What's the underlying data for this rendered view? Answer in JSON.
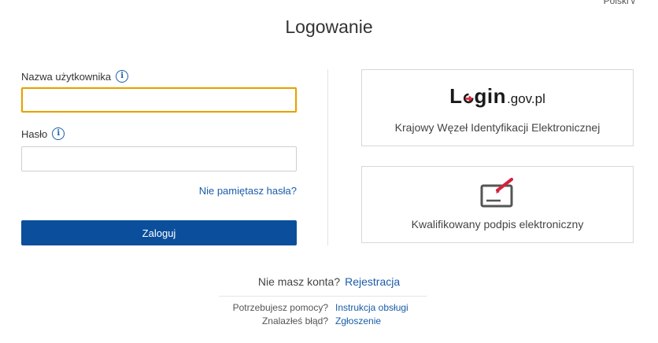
{
  "language": {
    "label": "Polski",
    "icon": "chevron-down-icon"
  },
  "header": {
    "title": "Logowanie"
  },
  "form": {
    "username_label": "Nazwa użytkownika",
    "username_value": "",
    "password_label": "Hasło",
    "password_value": "",
    "info_icon": "info-icon",
    "forgot_link": "Nie pamiętasz hasła?",
    "login_button": "Zaloguj"
  },
  "providers": {
    "login_gov": {
      "logo_l": "L",
      "logo_gin": "gin",
      "logo_suffix": ".gov.pl",
      "caption": "Krajowy Węzeł Identyfikacji Elektronicznej"
    },
    "qualified_signature": {
      "icon": "signature-icon",
      "caption": "Kwalifikowany podpis elektroniczny"
    }
  },
  "footer": {
    "register_question": "Nie masz konta?",
    "register_link": "Rejestracja",
    "help_question": "Potrzebujesz pomocy?",
    "help_link": "Instrukcja obsługi",
    "bug_question": "Znalazłeś błąd?",
    "bug_link": "Zgłoszenie"
  },
  "colors": {
    "accent": "#0b4f9c",
    "link": "#1a5ca8",
    "focus": "#e6a200",
    "logo_red": "#d4213d"
  }
}
